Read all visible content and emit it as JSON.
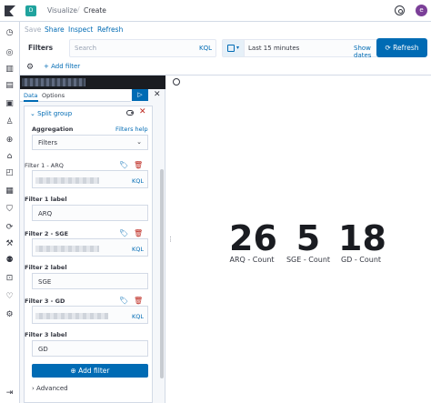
{
  "header": {
    "space_initial": "D",
    "breadcrumbs": [
      "Visualize",
      "Create"
    ],
    "avatar_initial": "e"
  },
  "menu": {
    "items": [
      "Save",
      "Share",
      "Inspect",
      "Refresh"
    ]
  },
  "filter_bar": {
    "filters_label": "Filters",
    "search_placeholder": "Search",
    "kql_label": "KQL",
    "time_range": "Last 15 minutes",
    "show_dates": "Show dates",
    "refresh_label": "Refresh",
    "add_filter": "+ Add filter"
  },
  "editor": {
    "tabs": [
      "Data",
      "Options"
    ],
    "split_group_label": "Split group",
    "aggregation_label": "Aggregation",
    "aggregation_help": "Filters help",
    "aggregation_value": "Filters",
    "filters": [
      {
        "title": "Filter 1 - ARQ",
        "kql": "KQL",
        "label_title": "Filter 1 label",
        "label_value": "ARQ"
      },
      {
        "title": "Filter 2 - SGE",
        "kql": "KQL",
        "label_title": "Filter 2 label",
        "label_value": "SGE"
      },
      {
        "title": "Filter 3 - GD",
        "kql": "KQL",
        "label_title": "Filter 3 label",
        "label_value": "GD"
      }
    ],
    "add_filter_button": "Add filter",
    "advanced": "Advanced"
  },
  "metrics": [
    {
      "value": "26",
      "label": "ARQ - Count"
    },
    {
      "value": "5",
      "label": "SGE - Count"
    },
    {
      "value": "18",
      "label": "GD - Count"
    }
  ],
  "colors": {
    "primary": "#006bb4",
    "danger": "#bd271e",
    "space_badge": "#20a39e",
    "avatar": "#7b3f98"
  }
}
